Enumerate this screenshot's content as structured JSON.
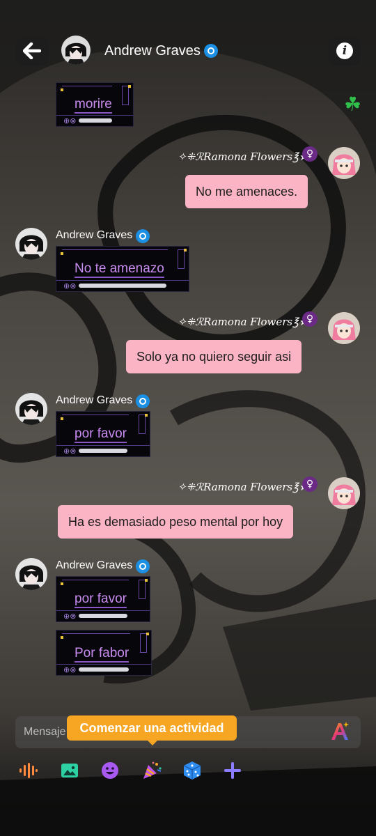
{
  "header": {
    "contact_name": "Andrew Graves"
  },
  "messages": {
    "m1": {
      "text": "morire"
    },
    "m2": {
      "sender": "✧⁜ℛRamona Flowers℥★",
      "text": "No me amenaces."
    },
    "m3": {
      "sender": "Andrew Graves",
      "text": "No te amenazo"
    },
    "m4": {
      "sender": "✧⁜ℛRamona Flowers℥★",
      "text": "Solo ya no quiero seguir asi"
    },
    "m5": {
      "sender": "Andrew Graves",
      "text": "por favor"
    },
    "m6": {
      "sender": "✧⁜ℛRamona Flowers℥★",
      "text": "Ha es demasiado peso mental por hoy"
    },
    "m7": {
      "sender": "Andrew Graves",
      "text": "por favor"
    },
    "m8": {
      "text": "Por fabor"
    }
  },
  "composer": {
    "placeholder": "Mensaje",
    "tooltip": "Comenzar una actividad"
  },
  "icons": {
    "back": "arrow-left-icon",
    "info": "info-icon",
    "verified": "verified-badge-icon",
    "clover": "shamrock-icon",
    "female": "venus-icon",
    "font": "text-style-icon",
    "toolbar": [
      "audio-wave-icon",
      "image-icon",
      "sticker-icon",
      "party-popper-icon",
      "dice-icon",
      "plus-icon"
    ]
  },
  "colors": {
    "pink_bubble": "#fbb4c4",
    "frame_text": "#c98cf0",
    "tooltip": "#f6a623",
    "verified": "#1a8fe3",
    "venus_badge": "#6b2a86"
  }
}
